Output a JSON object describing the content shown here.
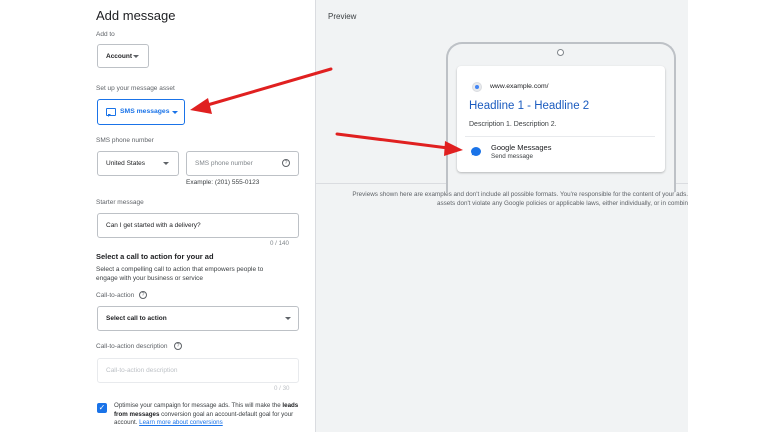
{
  "form": {
    "title": "Add message",
    "add_to_label": "Add to",
    "add_to_value": "Account",
    "asset_label": "Set up your message asset",
    "asset_value": "SMS messages",
    "phone_label": "SMS phone number",
    "country_value": "United States",
    "phone_placeholder": "SMS phone number",
    "phone_example": "Example: (201) 555-0123",
    "starter_label": "Starter message",
    "starter_placeholder": "Can I get started with a delivery?",
    "starter_counter": "0 / 140",
    "cta_section_title": "Select a call to action for your ad",
    "cta_section_desc_1": "Select a compelling call to action that empowers people to",
    "cta_section_desc_2": "engage with your business or service",
    "cta_label": "Call-to-action",
    "cta_value": "Select call to action",
    "cta_desc_label": "Call-to-action description",
    "cta_desc_placeholder": "Call-to-action description",
    "cta_desc_counter": "0 / 30",
    "optimise_pre": "Optimise your campaign for message ads. This will make the ",
    "optimise_bold": "leads from messages",
    "optimise_post": " conversion goal an account-default goal for your account. ",
    "optimise_link": "Learn more about conversions"
  },
  "preview": {
    "title": "Preview",
    "url": "www.example.com/",
    "headline": "Headline 1 - Headline 2",
    "description": "Description 1. Description 2.",
    "message_name": "Google Messages",
    "message_sub": "Send message",
    "disclaimer_1": "Previews shown here are examples and don't include all possible formats. You're responsible for the content of your ads.",
    "disclaimer_2": "assets don't violate any Google policies or applicable laws, either individually, or in combin"
  },
  "colors": {
    "accent": "#1a73e8",
    "annotation_arrow": "#e02020",
    "headline": "#1a5bbf"
  },
  "icons": [
    "chat-icon",
    "caret-down-icon",
    "help-icon",
    "globe-icon",
    "messages-icon",
    "checkbox-checked-icon"
  ]
}
